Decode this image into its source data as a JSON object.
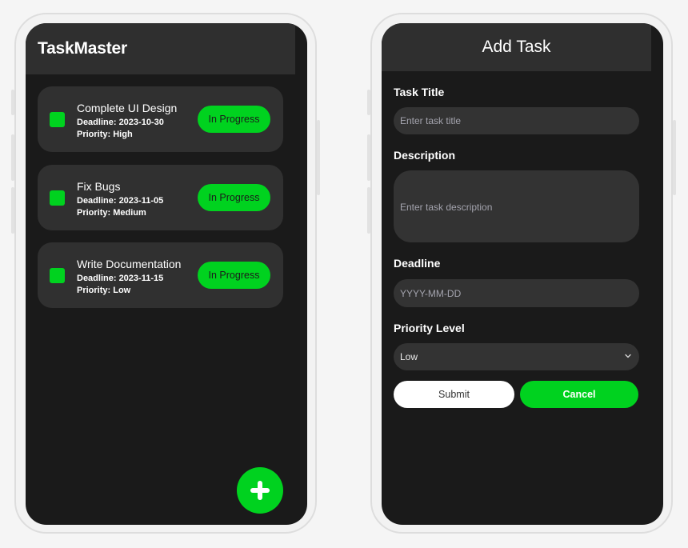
{
  "app": {
    "title": "TaskMaster",
    "accent_color": "#00d21f"
  },
  "tasks": [
    {
      "title": "Complete UI Design",
      "deadline": "Deadline: 2023-10-30",
      "priority": "Priority: High",
      "status": "In Progress"
    },
    {
      "title": "Fix Bugs",
      "deadline": "Deadline: 2023-11-05",
      "priority": "Priority: Medium",
      "status": "In Progress"
    },
    {
      "title": "Write Documentation",
      "deadline": "Deadline: 2023-11-15",
      "priority": "Priority: Low",
      "status": "In Progress"
    }
  ],
  "fab": {
    "icon": "plus-icon"
  },
  "form": {
    "title": "Add Task",
    "task_title_label": "Task Title",
    "task_title_placeholder": "Enter task title",
    "description_label": "Description",
    "description_placeholder": "Enter task description",
    "deadline_label": "Deadline",
    "deadline_placeholder": "YYYY-MM-DD",
    "priority_label": "Priority Level",
    "priority_value": "Low",
    "priority_icon": "chevron-down-icon",
    "submit_label": "Submit",
    "cancel_label": "Cancel"
  }
}
